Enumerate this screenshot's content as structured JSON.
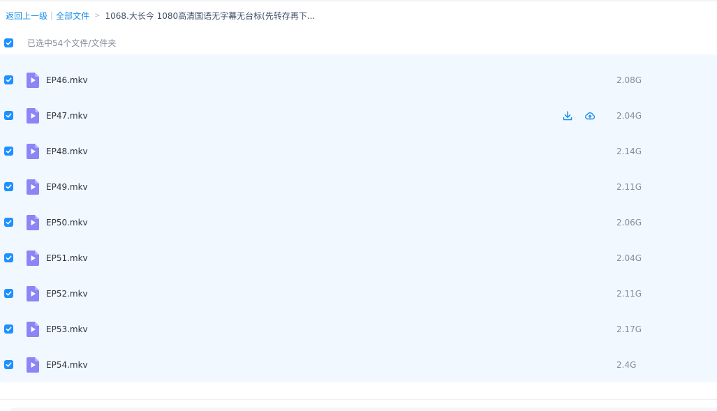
{
  "breadcrumb": {
    "back": "返回上一级",
    "separator": "|",
    "all_files": "全部文件",
    "arrow": ">",
    "current": "1068.大长今 1080高清国语无字幕无台标(先转存再下..."
  },
  "selection": {
    "label": "已选中54个文件/文件夹",
    "checked": true
  },
  "files": [
    {
      "name": "EP46.mkv",
      "size": "2.08G",
      "checked": true
    },
    {
      "name": "EP47.mkv",
      "size": "2.04G",
      "checked": true,
      "hover": true
    },
    {
      "name": "EP48.mkv",
      "size": "2.14G",
      "checked": true
    },
    {
      "name": "EP49.mkv",
      "size": "2.11G",
      "checked": true
    },
    {
      "name": "EP50.mkv",
      "size": "2.06G",
      "checked": true
    },
    {
      "name": "EP51.mkv",
      "size": "2.04G",
      "checked": true
    },
    {
      "name": "EP52.mkv",
      "size": "2.11G",
      "checked": true
    },
    {
      "name": "EP53.mkv",
      "size": "2.17G",
      "checked": true
    },
    {
      "name": "EP54.mkv",
      "size": "2.4G",
      "checked": true
    }
  ],
  "row_actions": [
    "download-icon",
    "cloud-upload-icon"
  ],
  "colors": {
    "accent": "#1e90ff",
    "link": "#1a8ee8",
    "list_bg": "#f1f8ff",
    "video_icon": "#8b85f5"
  }
}
